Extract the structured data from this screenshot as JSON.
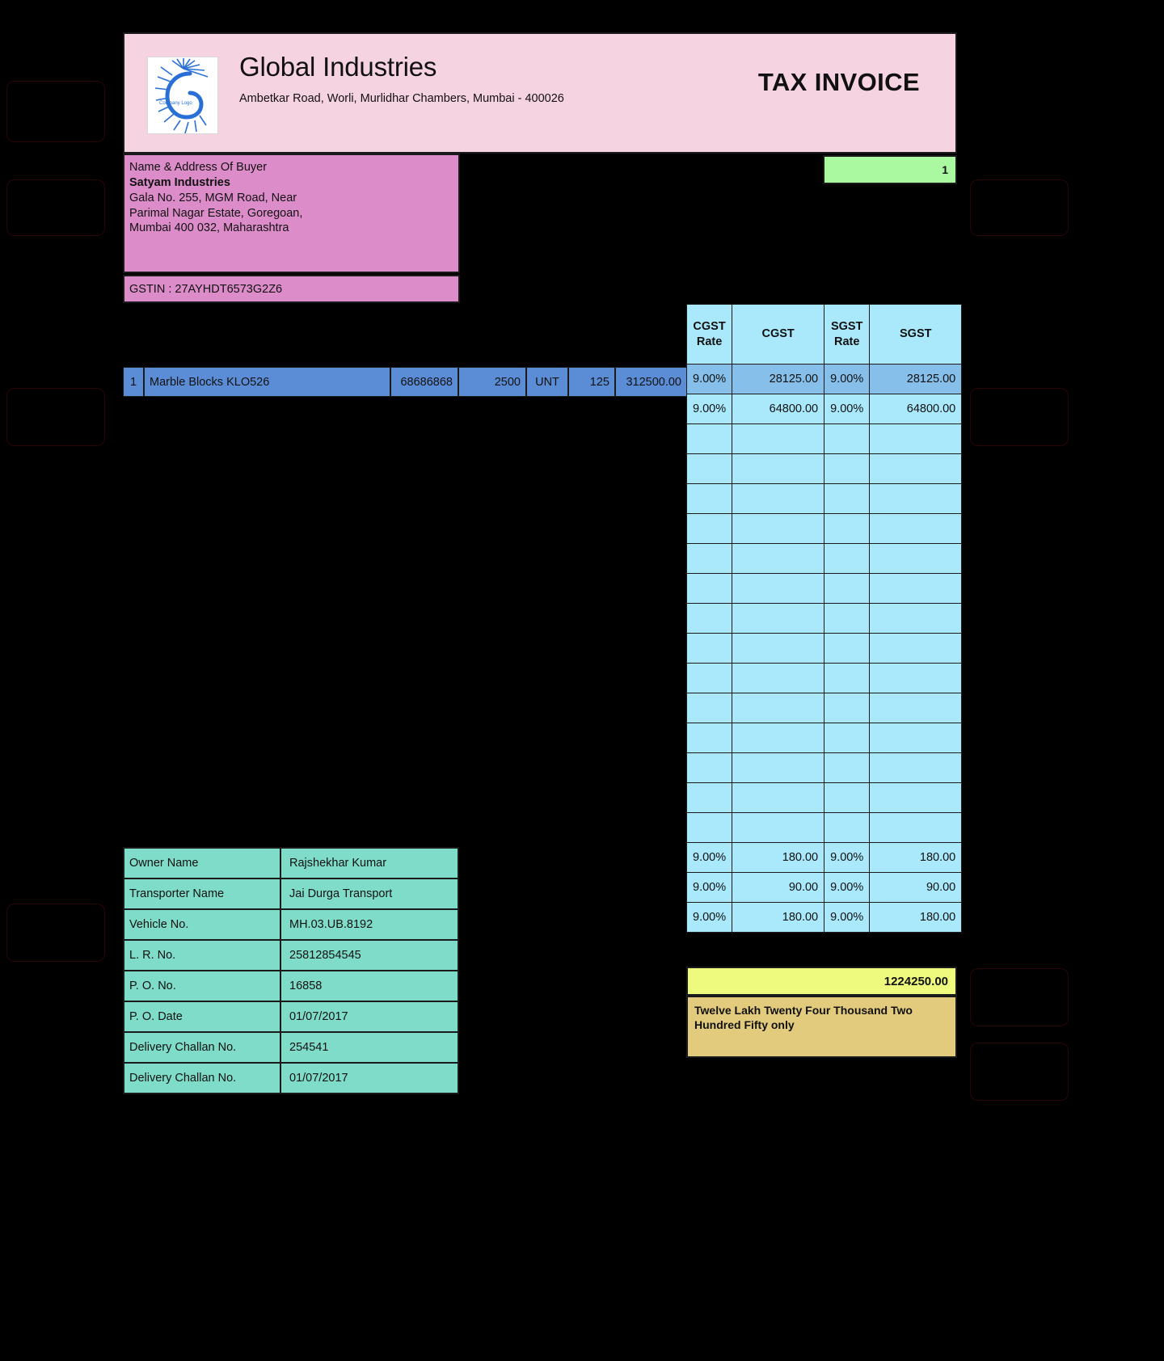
{
  "header": {
    "company_name": "Global Industries",
    "company_address": "Ambetkar Road, Worli, Murlidhar Chambers, Mumbai - 400026",
    "document_title": "TAX INVOICE",
    "logo_caption": "Company Logo"
  },
  "buyer": {
    "label": "Name & Address Of Buyer",
    "name": "Satyam Industries",
    "address_line_1": "Gala No. 255, MGM Road, Near",
    "address_line_2": "Parimal Nagar Estate, Goregoan,",
    "address_line_3": "Mumbai 400 032, Maharashtra",
    "gstin": "GSTIN : 27AYHDT6573G2Z6"
  },
  "invoice": {
    "number": "1"
  },
  "tax_table": {
    "headers": [
      "CGST Rate",
      "CGST",
      "SGST Rate",
      "SGST"
    ],
    "header_cgst_rate_line1": "CGST",
    "header_cgst_rate_line2": "Rate",
    "header_cgst": "CGST",
    "header_sgst_rate_line1": "SGST",
    "header_sgst_rate_line2": "Rate",
    "header_sgst": "SGST",
    "rows": [
      {
        "cgst_rate": "9.00%",
        "cgst": "28125.00",
        "sgst_rate": "9.00%",
        "sgst": "28125.00",
        "highlight": true
      },
      {
        "cgst_rate": "9.00%",
        "cgst": "64800.00",
        "sgst_rate": "9.00%",
        "sgst": "64800.00",
        "highlight": false
      },
      {
        "cgst_rate": "",
        "cgst": "",
        "sgst_rate": "",
        "sgst": "",
        "highlight": false
      },
      {
        "cgst_rate": "",
        "cgst": "",
        "sgst_rate": "",
        "sgst": "",
        "highlight": false
      },
      {
        "cgst_rate": "",
        "cgst": "",
        "sgst_rate": "",
        "sgst": "",
        "highlight": false
      },
      {
        "cgst_rate": "",
        "cgst": "",
        "sgst_rate": "",
        "sgst": "",
        "highlight": false
      },
      {
        "cgst_rate": "",
        "cgst": "",
        "sgst_rate": "",
        "sgst": "",
        "highlight": false
      },
      {
        "cgst_rate": "",
        "cgst": "",
        "sgst_rate": "",
        "sgst": "",
        "highlight": false
      },
      {
        "cgst_rate": "",
        "cgst": "",
        "sgst_rate": "",
        "sgst": "",
        "highlight": false
      },
      {
        "cgst_rate": "",
        "cgst": "",
        "sgst_rate": "",
        "sgst": "",
        "highlight": false
      },
      {
        "cgst_rate": "",
        "cgst": "",
        "sgst_rate": "",
        "sgst": "",
        "highlight": false
      },
      {
        "cgst_rate": "",
        "cgst": "",
        "sgst_rate": "",
        "sgst": "",
        "highlight": false
      },
      {
        "cgst_rate": "",
        "cgst": "",
        "sgst_rate": "",
        "sgst": "",
        "highlight": false
      },
      {
        "cgst_rate": "",
        "cgst": "",
        "sgst_rate": "",
        "sgst": "",
        "highlight": false
      },
      {
        "cgst_rate": "",
        "cgst": "",
        "sgst_rate": "",
        "sgst": "",
        "highlight": false
      },
      {
        "cgst_rate": "",
        "cgst": "",
        "sgst_rate": "",
        "sgst": "",
        "highlight": false
      },
      {
        "cgst_rate": "9.00%",
        "cgst": "180.00",
        "sgst_rate": "9.00%",
        "sgst": "180.00",
        "highlight": false
      },
      {
        "cgst_rate": "9.00%",
        "cgst": "90.00",
        "sgst_rate": "9.00%",
        "sgst": "90.00",
        "highlight": false
      },
      {
        "cgst_rate": "9.00%",
        "cgst": "180.00",
        "sgst_rate": "9.00%",
        "sgst": "180.00",
        "highlight": false
      }
    ]
  },
  "line_item": {
    "sr_no": "1",
    "description": "Marble Blocks KLO526",
    "hsn_code": "68686868",
    "rate": "2500",
    "unit": "UNT",
    "quantity": "125",
    "amount": "312500.00"
  },
  "transport_info": {
    "rows": [
      {
        "key": "Owner Name",
        "value": "Rajshekhar Kumar"
      },
      {
        "key": "Transporter Name",
        "value": "Jai Durga Transport"
      },
      {
        "key": "Vehicle No.",
        "value": "MH.03.UB.8192"
      },
      {
        "key": "L. R. No.",
        "value": "25812854545"
      },
      {
        "key": "P. O. No.",
        "value": "16858"
      },
      {
        "key": "P. O. Date",
        "value": "01/07/2017"
      },
      {
        "key": "Delivery Challan No.",
        "value": "254541"
      },
      {
        "key": "Delivery Challan No.",
        "value": "01/07/2017"
      }
    ]
  },
  "totals": {
    "grand_total": "1224250.00",
    "amount_in_words": "Twelve Lakh Twenty Four Thousand Two Hundred Fifty  only"
  },
  "colors": {
    "header_band": "#f6d3e0",
    "buyer_block": "#dd8cca",
    "invoice_no_box": "#aaf9a1",
    "tax_grid": "#aae9fb",
    "tax_grid_highlight": "#85bfea",
    "line_item": "#5b8dd6",
    "info_table": "#7fdcc8",
    "grand_total": "#eefa7d",
    "amount_words": "#e3cb7e",
    "page_background": "#000000"
  }
}
